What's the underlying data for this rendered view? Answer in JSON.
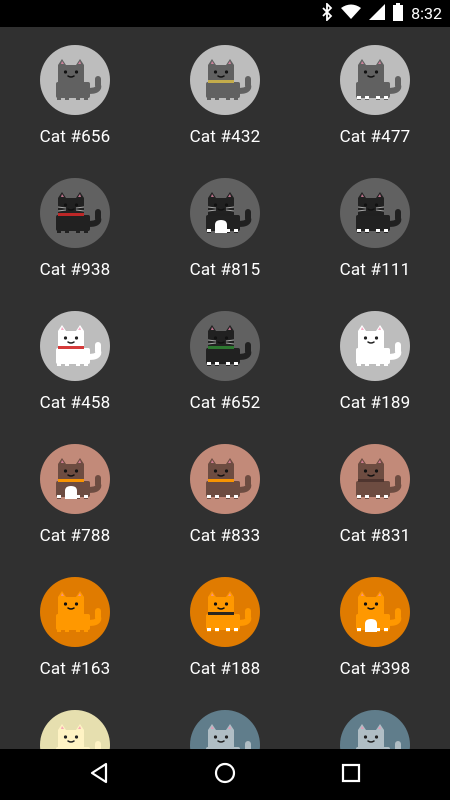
{
  "status": {
    "time": "8:32"
  },
  "cats": [
    {
      "label": "Cat #656",
      "bg": "#BDBDBD",
      "body": "#616161",
      "collar": "#616161",
      "has_chest": false,
      "has_whisker_lines": false,
      "has_feet": false
    },
    {
      "label": "Cat #432",
      "bg": "#BDBDBD",
      "body": "#616161",
      "collar": "#C8B04A",
      "has_chest": false,
      "has_whisker_lines": false,
      "has_feet": false
    },
    {
      "label": "Cat #477",
      "bg": "#BDBDBD",
      "body": "#616161",
      "collar": "#616161",
      "has_chest": false,
      "has_whisker_lines": false,
      "has_feet": true
    },
    {
      "label": "Cat #938",
      "bg": "#616161",
      "body": "#212121",
      "collar": "#C62828",
      "has_chest": false,
      "has_whisker_lines": true,
      "has_feet": false
    },
    {
      "label": "Cat #815",
      "bg": "#616161",
      "body": "#212121",
      "collar": "#212121",
      "has_chest": true,
      "has_whisker_lines": true,
      "has_feet": true
    },
    {
      "label": "Cat #111",
      "bg": "#616161",
      "body": "#212121",
      "collar": "#212121",
      "has_chest": false,
      "has_whisker_lines": true,
      "has_feet": true
    },
    {
      "label": "Cat #458",
      "bg": "#BDBDBD",
      "body": "#FFFFFF",
      "collar": "#D32F2F",
      "has_chest": false,
      "has_whisker_lines": false,
      "has_feet": false
    },
    {
      "label": "Cat #652",
      "bg": "#616161",
      "body": "#212121",
      "collar": "#2E7D32",
      "has_chest": false,
      "has_whisker_lines": true,
      "has_feet": true
    },
    {
      "label": "Cat #189",
      "bg": "#BDBDBD",
      "body": "#FFFFFF",
      "collar": "#FFFFFF",
      "has_chest": false,
      "has_whisker_lines": false,
      "has_feet": false
    },
    {
      "label": "Cat #788",
      "bg": "#C28A79",
      "body": "#6D4C41",
      "collar": "#FF9800",
      "has_chest": true,
      "has_whisker_lines": false,
      "has_feet": true
    },
    {
      "label": "Cat #833",
      "bg": "#C28A79",
      "body": "#6D4C41",
      "collar": "#FF9800",
      "has_chest": false,
      "has_whisker_lines": false,
      "has_feet": true
    },
    {
      "label": "Cat #831",
      "bg": "#C28A79",
      "body": "#6D4C41",
      "collar": "#4E342E",
      "has_chest": false,
      "has_whisker_lines": false,
      "has_feet": true
    },
    {
      "label": "Cat #163",
      "bg": "#E07B00",
      "body": "#FF9800",
      "collar": "#FF9800",
      "has_chest": false,
      "has_whisker_lines": false,
      "has_feet": false
    },
    {
      "label": "Cat #188",
      "bg": "#E07B00",
      "body": "#FF9800",
      "collar": "#212121",
      "has_chest": false,
      "has_whisker_lines": false,
      "has_feet": true
    },
    {
      "label": "Cat #398",
      "bg": "#E07B00",
      "body": "#FF9800",
      "collar": "#FF9800",
      "has_chest": true,
      "has_whisker_lines": false,
      "has_feet": true
    },
    {
      "label": "",
      "bg": "#E6DFAF",
      "body": "#FFF3C4",
      "collar": "#FFF3C4",
      "has_chest": false,
      "has_whisker_lines": false,
      "has_feet": false
    },
    {
      "label": "",
      "bg": "#607D8B",
      "body": "#B0BEC5",
      "collar": "#B0BEC5",
      "has_chest": false,
      "has_whisker_lines": false,
      "has_feet": false
    },
    {
      "label": "",
      "bg": "#607D8B",
      "body": "#B0BEC5",
      "collar": "#B0BEC5",
      "has_chest": false,
      "has_whisker_lines": false,
      "has_feet": false
    }
  ],
  "nav": {
    "back": "back-icon",
    "home": "home-icon",
    "recents": "recents-icon"
  }
}
